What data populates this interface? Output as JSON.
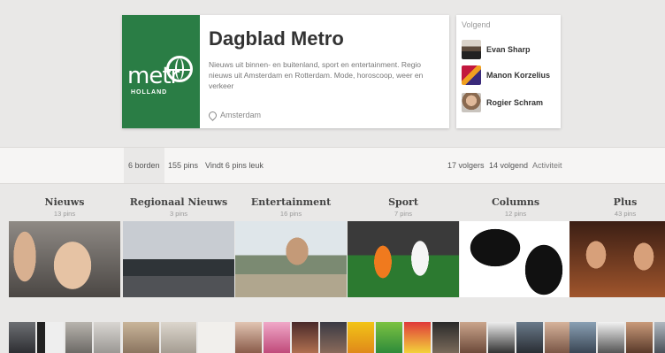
{
  "profile": {
    "name": "Dagblad Metro",
    "description": "Nieuws uit binnen- en buitenland, sport en entertainment. Regio nieuws uit Amsterdam en Rotterdam. Mode, horoscoop, weer en verkeer",
    "location": "Amsterdam",
    "logo": {
      "word": "metr",
      "sub": "HOLLAND"
    }
  },
  "following": {
    "title": "Volgend",
    "people": [
      {
        "name": "Evan Sharp"
      },
      {
        "name": "Manon Korzelius"
      },
      {
        "name": "Rogier Schram"
      }
    ]
  },
  "stats": {
    "boards": "6 borden",
    "pins": "155 pins",
    "likes": "Vindt 6 pins leuk",
    "followers": "17 volgers",
    "following": "14 volgend",
    "activity": "Activiteit"
  },
  "boards": [
    {
      "title": "Nieuws",
      "count": "13 pins"
    },
    {
      "title": "Regionaal Nieuws",
      "count": "3 pins"
    },
    {
      "title": "Entertainment",
      "count": "16 pins"
    },
    {
      "title": "Sport",
      "count": "7 pins"
    },
    {
      "title": "Columns",
      "count": "12 pins"
    },
    {
      "title": "Plus",
      "count": "43 pins"
    }
  ],
  "colors": {
    "brand_green": "#2a7d45",
    "background": "#e9e8e7"
  }
}
